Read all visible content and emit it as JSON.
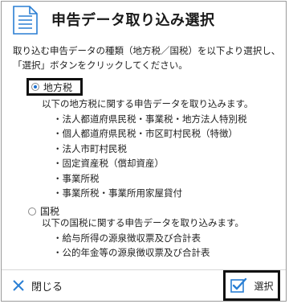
{
  "dialog": {
    "title": "申告データ取り込み選択",
    "description": [
      "取り込む申告データの種類（地方税／国税）を以下より選択し、",
      "「選択」ボタンをクリックしてください。"
    ]
  },
  "options": [
    {
      "label": "地方税",
      "checked": true,
      "intro": "以下の地方税に関する申告データを取り込みます。",
      "items": [
        "法人都道府県民税・事業税・地方法人特別税",
        "個人都道府県民税・市区町村民税（特徴）",
        "法人市町村民税",
        "固定資産税（償却資産）",
        "事業所税",
        "事業所税・事業所用家屋貸付"
      ]
    },
    {
      "label": "国税",
      "checked": false,
      "intro": "以下の国税に関する申告データを取り込みます。",
      "items": [
        "給与所得の源泉徴収票及び合計表",
        "公的年金等の源泉徴収票及び合計表"
      ]
    }
  ],
  "footer": {
    "close_label": "閉じる",
    "select_label": "選択"
  },
  "icons": {
    "header": "document-icon",
    "close": "close-icon",
    "select": "check-icon"
  },
  "colors": {
    "accent": "#2a7fd4",
    "radio_selected": "#1a6fd0"
  }
}
